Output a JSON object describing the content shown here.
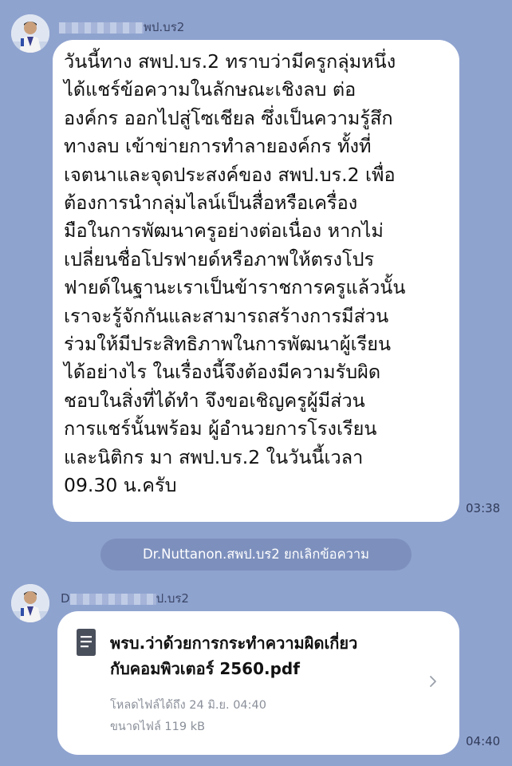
{
  "messages": [
    {
      "sender_visible": "พป.บร2",
      "text": "วันนี้ทาง สพป.บร.2 ทราบว่ามีครูกลุ่มหนึ่ง\nได้แชร์ข้อความในลักษณะเชิงลบ ต่อ\nองค์กร ออกไปสู่โซเชียล ซึ่งเป็นความรู้สึก\nทางลบ เข้าข่ายการทำลายองค์กร ทั้งที่\nเจตนาและจุดประสงค์ของ สพป.บร.2 เพื่อ\nต้องการนำกลุ่มไลน์เป็นสื่อหรือเครื่อง\nมือในการพัฒนาครูอย่างต่อเนื่อง หากไม่\nเปลี่ยนชื่อโปรฟายด์หรือภาพให้ตรงโปร\nฟายด์ในฐานะเราเป็นข้าราชการครูแล้วนั้น\nเราจะรู้จักกันและสามารถสร้างการมีส่วน\nร่วมให้มีประสิทธิภาพในการพัฒนาผู้เรียน\nได้อย่างไร  ในเรื่องนี้จึงต้องมีความรับผิด\nชอบในสิ่งที่ได้ทำ จึงขอเชิญครูผู้มีส่วน\nการแชร์นั้นพร้อม ผู้อำนวยการโรงเรียน\nและนิติกร มา สพป.บร.2 ในวันนี้เวลา\n09.30 น.ครับ",
      "time": "03:38"
    },
    {
      "sender_prefix": "D",
      "sender_visible": "ป.บร2",
      "file_name": "พรบ.ว่าด้วยการกระทำความผิดเกี่ยว\nกับคอมพิวเตอร์ 2560.pdf",
      "download_until": "โหลดไฟล์ได้ถึง 24 มิ.ย. 04:40",
      "file_size": "ขนาดไฟล์ 119 kB",
      "time": "04:40"
    }
  ],
  "system_notice": "Dr.Nuttanon.สพป.บร2 ยกเลิกข้อความ",
  "icons": {
    "file": "document-icon",
    "chevron": "chevron-right-icon"
  },
  "colors": {
    "background": "#8fa3cf",
    "bubble": "#ffffff",
    "system_pill": "#7d90bd"
  }
}
